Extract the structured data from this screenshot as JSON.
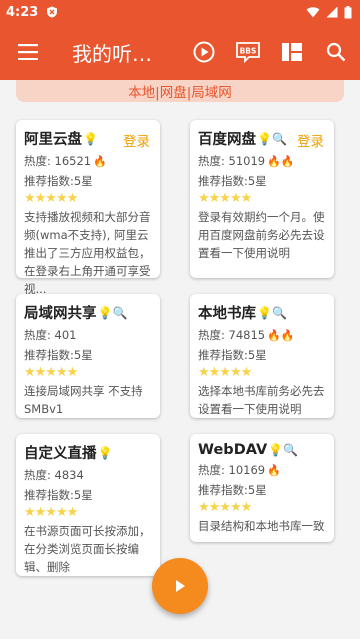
{
  "status": {
    "time": "4:23"
  },
  "appbar": {
    "title": "我的听…",
    "icons": [
      "menu-icon",
      "play-icon",
      "bbs-icon",
      "grid-icon",
      "search-icon"
    ]
  },
  "banner": {
    "text": "本地|网盘|局域网"
  },
  "cards": [
    {
      "name": "阿里云盘",
      "emoji": "💡",
      "login": "登录",
      "heat_label": "热度: 16521",
      "rec_label": "推荐指数:5星",
      "stars": "★★★★★",
      "desc": "支持播放视频和大部分音频(wma不支持), 阿里云推出了三方应用权益包，在登录右上角开通可享受视..."
    },
    {
      "name": "百度网盘",
      "emoji": "💡🔍",
      "login": "登录",
      "heat_label": "热度: 51019",
      "rec_label": "推荐指数:5星",
      "stars": "★★★★★",
      "desc": "登录有效期约一个月。使用百度网盘前务必先去设置看一下使用说明"
    },
    {
      "name": "局域网共享",
      "emoji": "💡🔍",
      "heat_label": "热度: 401",
      "rec_label": "推荐指数:5星",
      "stars": "★★★★★",
      "desc": "连接局域网共享 不支持SMBv1"
    },
    {
      "name": "本地书库",
      "emoji": "💡🔍",
      "heat_label": "热度: 74815",
      "rec_label": "推荐指数:5星",
      "stars": "★★★★★",
      "desc": "选择本地书库前务必先去设置看一下使用说明"
    },
    {
      "name": "自定义直播",
      "emoji": "💡",
      "heat_label": "热度: 4834",
      "rec_label": "推荐指数:5星",
      "stars": "★★★★★",
      "desc": "在书源页面可长按添加，在分类浏览页面长按编辑、删除"
    },
    {
      "name": "WebDAV",
      "emoji": "💡🔍",
      "heat_label": "热度: 10169",
      "rec_label": "推荐指数:5星",
      "stars": "★★★★★",
      "desc": "目录结构和本地书库一致"
    }
  ],
  "colors": {
    "primary": "#e8552f",
    "banner_bg": "#f7d4c5",
    "login": "#f0a000",
    "fab": "#f58a1f",
    "star": "#f7d24a"
  }
}
